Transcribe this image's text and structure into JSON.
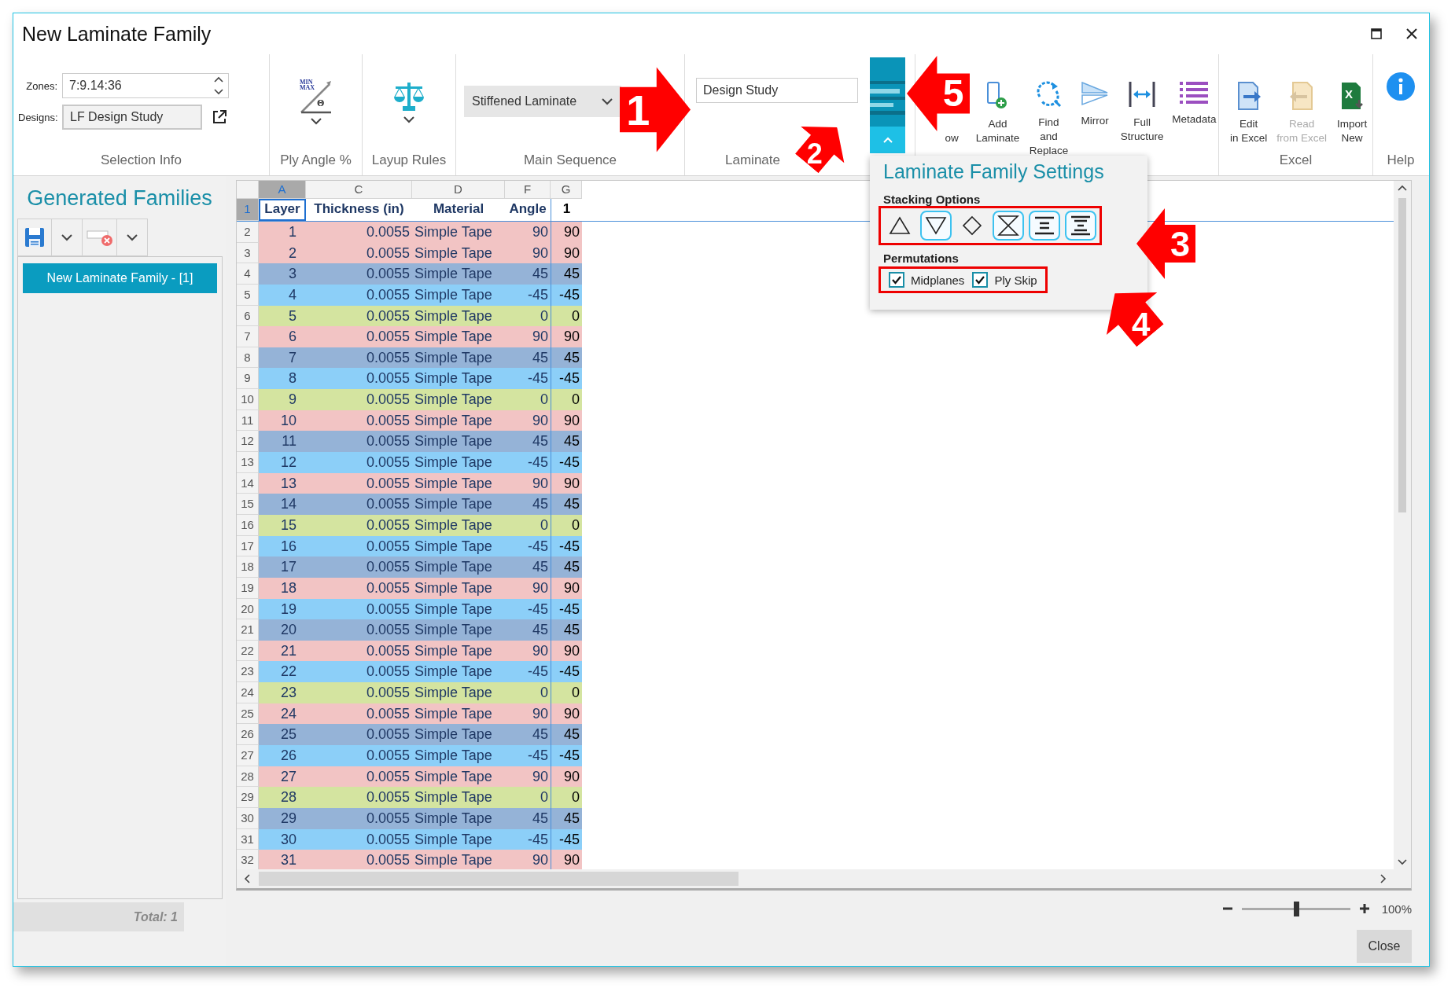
{
  "window": {
    "title": "New Laminate Family"
  },
  "ribbon": {
    "selection_info": {
      "zones_label": "Zones:",
      "zones_value": "7:9.14:36",
      "designs_label": "Designs:",
      "designs_value": "LF Design Study",
      "group_label": "Selection Info"
    },
    "ply_angle": {
      "icon_texts": [
        "MIN",
        "MAX",
        "Θ"
      ],
      "group_label": "Ply Angle %"
    },
    "layup_rules": {
      "group_label": "Layup Rules"
    },
    "main_sequence": {
      "value": "Stiffened Laminate",
      "group_label": "Main Sequence"
    },
    "laminate_family": {
      "value": "Design Study",
      "group_label": "Laminate"
    },
    "tools": [
      {
        "kind": "partial",
        "label": "ow",
        "disabled": false
      },
      {
        "kind": "add_laminate",
        "label": "Add\nLaminate",
        "disabled": false
      },
      {
        "kind": "find_replace",
        "label": "Find and\nReplace",
        "disabled": false
      },
      {
        "kind": "mirror",
        "label": "Mirror",
        "disabled": false
      },
      {
        "kind": "full_structure",
        "label": "Full\nStructure",
        "disabled": false
      },
      {
        "kind": "metadata",
        "label": "Metadata",
        "disabled": false
      }
    ],
    "excel": {
      "group_label": "Excel",
      "buttons": [
        {
          "kind": "edit_excel",
          "label": "Edit\nin Excel",
          "disabled": false
        },
        {
          "kind": "read_excel",
          "label": "Read\nfrom Excel",
          "disabled": true
        },
        {
          "kind": "import_new",
          "label": "Import\nNew",
          "icon_text": "X",
          "disabled": false
        }
      ]
    },
    "help": {
      "group_label": "Help"
    }
  },
  "left_panel": {
    "title": "Generated Families",
    "items": [
      {
        "label": "New Laminate Family - [1]",
        "selected": true
      }
    ],
    "total": "Total: 1"
  },
  "sheet": {
    "columns": [
      {
        "letter": "A",
        "selected": true
      },
      {
        "letter": "C",
        "selected": false
      },
      {
        "letter": "D",
        "selected": false
      },
      {
        "letter": "F",
        "selected": false
      },
      {
        "letter": "G",
        "selected": false
      }
    ],
    "header_row": {
      "number": "1",
      "selected": true,
      "cells": [
        "Layer",
        "Thickness (in)",
        "Material",
        "Angle",
        "1"
      ]
    },
    "rows": [
      {
        "number": "2",
        "selected": false,
        "color": "#f2c4c4",
        "cells": [
          "1",
          "0.0055",
          "Simple Tape",
          "90",
          "90"
        ]
      },
      {
        "number": "3",
        "selected": false,
        "color": "#f2c4c4",
        "cells": [
          "2",
          "0.0055",
          "Simple Tape",
          "90",
          "90"
        ]
      },
      {
        "number": "4",
        "selected": false,
        "color": "#95b3d7",
        "cells": [
          "3",
          "0.0055",
          "Simple Tape",
          "45",
          "45"
        ]
      },
      {
        "number": "5",
        "selected": false,
        "color": "#8ccff8",
        "cells": [
          "4",
          "0.0055",
          "Simple Tape",
          "-45",
          "-45"
        ]
      },
      {
        "number": "6",
        "selected": false,
        "color": "#d4e4a0",
        "cells": [
          "5",
          "0.0055",
          "Simple Tape",
          "0",
          "0"
        ]
      },
      {
        "number": "7",
        "selected": false,
        "color": "#f2c4c4",
        "cells": [
          "6",
          "0.0055",
          "Simple Tape",
          "90",
          "90"
        ]
      },
      {
        "number": "8",
        "selected": false,
        "color": "#95b3d7",
        "cells": [
          "7",
          "0.0055",
          "Simple Tape",
          "45",
          "45"
        ]
      },
      {
        "number": "9",
        "selected": false,
        "color": "#8ccff8",
        "cells": [
          "8",
          "0.0055",
          "Simple Tape",
          "-45",
          "-45"
        ]
      },
      {
        "number": "10",
        "selected": false,
        "color": "#d4e4a0",
        "cells": [
          "9",
          "0.0055",
          "Simple Tape",
          "0",
          "0"
        ]
      },
      {
        "number": "11",
        "selected": false,
        "color": "#f2c4c4",
        "cells": [
          "10",
          "0.0055",
          "Simple Tape",
          "90",
          "90"
        ]
      },
      {
        "number": "12",
        "selected": false,
        "color": "#95b3d7",
        "cells": [
          "11",
          "0.0055",
          "Simple Tape",
          "45",
          "45"
        ]
      },
      {
        "number": "13",
        "selected": false,
        "color": "#8ccff8",
        "cells": [
          "12",
          "0.0055",
          "Simple Tape",
          "-45",
          "-45"
        ]
      },
      {
        "number": "14",
        "selected": false,
        "color": "#f2c4c4",
        "cells": [
          "13",
          "0.0055",
          "Simple Tape",
          "90",
          "90"
        ]
      },
      {
        "number": "15",
        "selected": false,
        "color": "#95b3d7",
        "cells": [
          "14",
          "0.0055",
          "Simple Tape",
          "45",
          "45"
        ]
      },
      {
        "number": "16",
        "selected": false,
        "color": "#d4e4a0",
        "cells": [
          "15",
          "0.0055",
          "Simple Tape",
          "0",
          "0"
        ]
      },
      {
        "number": "17",
        "selected": false,
        "color": "#8ccff8",
        "cells": [
          "16",
          "0.0055",
          "Simple Tape",
          "-45",
          "-45"
        ]
      },
      {
        "number": "18",
        "selected": false,
        "color": "#95b3d7",
        "cells": [
          "17",
          "0.0055",
          "Simple Tape",
          "45",
          "45"
        ]
      },
      {
        "number": "19",
        "selected": false,
        "color": "#f2c4c4",
        "cells": [
          "18",
          "0.0055",
          "Simple Tape",
          "90",
          "90"
        ]
      },
      {
        "number": "20",
        "selected": false,
        "color": "#8ccff8",
        "cells": [
          "19",
          "0.0055",
          "Simple Tape",
          "-45",
          "-45"
        ]
      },
      {
        "number": "21",
        "selected": false,
        "color": "#95b3d7",
        "cells": [
          "20",
          "0.0055",
          "Simple Tape",
          "45",
          "45"
        ]
      },
      {
        "number": "22",
        "selected": false,
        "color": "#f2c4c4",
        "cells": [
          "21",
          "0.0055",
          "Simple Tape",
          "90",
          "90"
        ]
      },
      {
        "number": "23",
        "selected": false,
        "color": "#8ccff8",
        "cells": [
          "22",
          "0.0055",
          "Simple Tape",
          "-45",
          "-45"
        ]
      },
      {
        "number": "24",
        "selected": false,
        "color": "#d4e4a0",
        "cells": [
          "23",
          "0.0055",
          "Simple Tape",
          "0",
          "0"
        ]
      },
      {
        "number": "25",
        "selected": false,
        "color": "#f2c4c4",
        "cells": [
          "24",
          "0.0055",
          "Simple Tape",
          "90",
          "90"
        ]
      },
      {
        "number": "26",
        "selected": false,
        "color": "#95b3d7",
        "cells": [
          "25",
          "0.0055",
          "Simple Tape",
          "45",
          "45"
        ]
      },
      {
        "number": "27",
        "selected": false,
        "color": "#8ccff8",
        "cells": [
          "26",
          "0.0055",
          "Simple Tape",
          "-45",
          "-45"
        ]
      },
      {
        "number": "28",
        "selected": false,
        "color": "#f2c4c4",
        "cells": [
          "27",
          "0.0055",
          "Simple Tape",
          "90",
          "90"
        ]
      },
      {
        "number": "29",
        "selected": false,
        "color": "#d4e4a0",
        "cells": [
          "28",
          "0.0055",
          "Simple Tape",
          "0",
          "0"
        ]
      },
      {
        "number": "30",
        "selected": false,
        "color": "#95b3d7",
        "cells": [
          "29",
          "0.0055",
          "Simple Tape",
          "45",
          "45"
        ]
      },
      {
        "number": "31",
        "selected": false,
        "color": "#8ccff8",
        "cells": [
          "30",
          "0.0055",
          "Simple Tape",
          "-45",
          "-45"
        ]
      },
      {
        "number": "32",
        "selected": false,
        "color": "#f2c4c4",
        "cells": [
          "31",
          "0.0055",
          "Simple Tape",
          "90",
          "90"
        ]
      }
    ]
  },
  "popup": {
    "title": "Laminate Family Settings",
    "stacking_label": "Stacking Options",
    "stacking_highlighted": true,
    "stacking_options": [
      {
        "kind": "triangle_up",
        "selected": false
      },
      {
        "kind": "triangle_down",
        "selected": true
      },
      {
        "kind": "diamond",
        "selected": false
      },
      {
        "kind": "hourglass",
        "selected": true
      },
      {
        "kind": "lines_center",
        "selected": true
      },
      {
        "kind": "lines_stack",
        "selected": true
      }
    ],
    "permutations_label": "Permutations",
    "permutations_highlighted": true,
    "checkboxes": [
      {
        "label": "Midplanes",
        "checked": true
      },
      {
        "label": "Ply Skip",
        "checked": true
      }
    ]
  },
  "zoom": {
    "level": 0.5,
    "reading": "100%"
  },
  "close_button": "Close",
  "callouts": [
    {
      "number": "1"
    },
    {
      "number": "2"
    },
    {
      "number": "5"
    },
    {
      "number": "3"
    },
    {
      "number": "4"
    }
  ]
}
